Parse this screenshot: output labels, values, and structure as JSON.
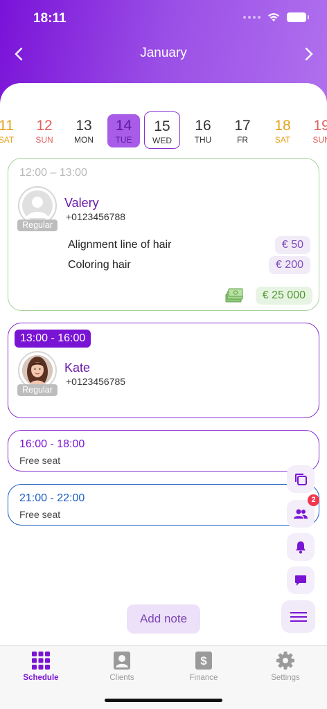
{
  "status_bar": {
    "time": "18:11"
  },
  "header": {
    "month": "January",
    "prev_icon": "chevron-left-icon",
    "next_icon": "chevron-right-icon"
  },
  "days": [
    {
      "num": "11",
      "wd": "SAT",
      "color": "#e3a21a"
    },
    {
      "num": "12",
      "wd": "SUN",
      "color": "#e0605e"
    },
    {
      "num": "13",
      "wd": "MON",
      "color": "#333333"
    },
    {
      "num": "14",
      "wd": "TUE",
      "color": "#5a1aa0",
      "selected": true
    },
    {
      "num": "15",
      "wd": "WED",
      "color": "#333333",
      "today": true
    },
    {
      "num": "16",
      "wd": "THU",
      "color": "#333333"
    },
    {
      "num": "17",
      "wd": "FR",
      "color": "#333333"
    },
    {
      "num": "18",
      "wd": "SAT",
      "color": "#e3a21a"
    },
    {
      "num": "19",
      "wd": "SUN",
      "color": "#e0605e"
    }
  ],
  "appointments": [
    {
      "time": "12:00  –  13:00",
      "client": "Valery",
      "phone": "+0123456788",
      "tag": "Regular",
      "services": [
        {
          "name": "Alignment line of hair",
          "price": "€  50"
        },
        {
          "name": "Coloring hair",
          "price": "€  200"
        }
      ],
      "total": "€  25 000",
      "border_color": "#a7d39a"
    },
    {
      "time": "13:00  -  16:00",
      "client": "Kate",
      "phone": "+0123456785",
      "tag": "Regular",
      "border_color": "#8a2fd0"
    }
  ],
  "free_slots": [
    {
      "time": "16:00  -  18:00",
      "label": "Free seat",
      "color": "#7a14d4"
    },
    {
      "time": "21:00  -  22:00",
      "label": "Free seat",
      "color": "#1a5fc4"
    }
  ],
  "side_actions": {
    "copy_icon": "copy-icon",
    "clients_icon": "people-icon",
    "clients_badge": "2",
    "bell_icon": "bell-icon",
    "chat_icon": "chat-icon",
    "menu_icon": "menu-icon"
  },
  "add_note": "Add note",
  "tabbar": [
    {
      "label": "Schedule",
      "icon": "grid-icon",
      "active": true
    },
    {
      "label": "Clients",
      "icon": "person-card-icon"
    },
    {
      "label": "Finance",
      "icon": "dollar-icon"
    },
    {
      "label": "Settings",
      "icon": "gear-icon"
    }
  ],
  "colors": {
    "accent": "#7a14d4",
    "header_start": "#7a12d8",
    "header_end": "#b070ee",
    "green": "#4f9a2e"
  }
}
